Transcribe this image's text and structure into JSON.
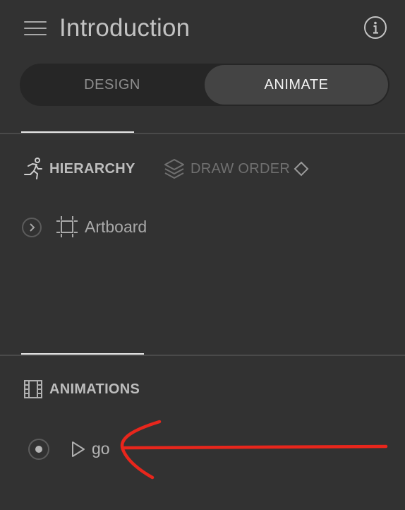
{
  "header": {
    "title": "Introduction",
    "menu_icon": "hamburger-menu-icon",
    "info_icon": "info-icon"
  },
  "mode_toggle": {
    "options": [
      "DESIGN",
      "ANIMATE"
    ],
    "selected": "ANIMATE"
  },
  "hierarchy_panel": {
    "tabs": [
      {
        "label": "HIERARCHY",
        "icon": "running-figure-icon",
        "active": true
      },
      {
        "label": "DRAW ORDER",
        "icon": "layers-icon",
        "active": false
      }
    ],
    "draw_order_badge_icon": "diamond-icon",
    "items": [
      {
        "label": "Artboard",
        "icon": "artboard-icon",
        "expand_icon": "chevron-right-icon"
      }
    ]
  },
  "animations_panel": {
    "title": "ANIMATIONS",
    "icon": "film-strip-icon",
    "items": [
      {
        "label": "go",
        "radio_icon": "radio-selected-icon",
        "play_icon": "play-icon"
      }
    ]
  },
  "colors": {
    "background": "#323232",
    "segment_track": "#262626",
    "segment_active": "#444444",
    "annotation_arrow": "#e8261c"
  }
}
